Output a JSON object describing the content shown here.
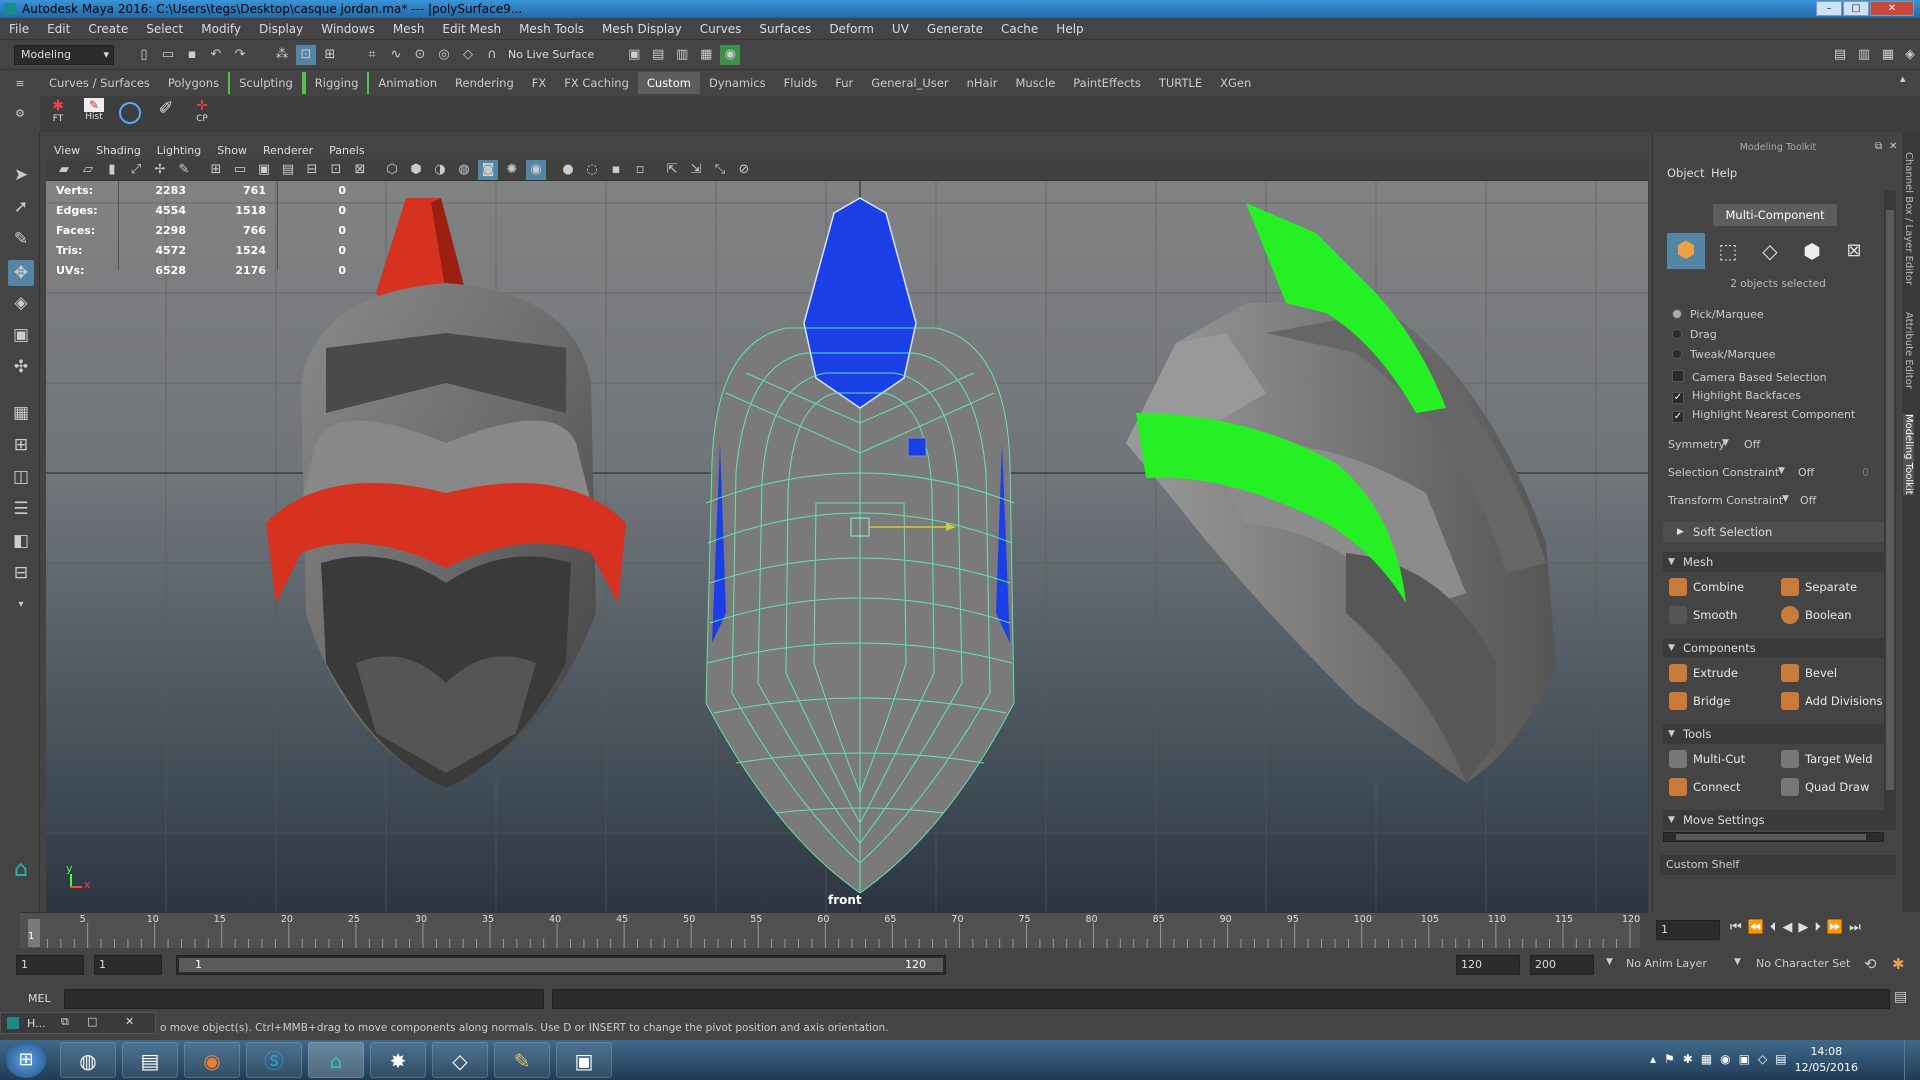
{
  "window": {
    "title": "Autodesk Maya 2016: C:\\Users\\tegs\\Desktop\\casque jordan.ma*   ---   |polySurface9..."
  },
  "menus": [
    "File",
    "Edit",
    "Create",
    "Select",
    "Modify",
    "Display",
    "Windows",
    "Mesh",
    "Edit Mesh",
    "Mesh Tools",
    "Mesh Display",
    "Curves",
    "Surfaces",
    "Deform",
    "UV",
    "Generate",
    "Cache",
    "Help"
  ],
  "status": {
    "mode": "Modeling",
    "live_surface": "No Live Surface"
  },
  "shelf_tabs": [
    "Curves / Surfaces",
    "Polygons",
    "Sculpting",
    "Rigging",
    "Animation",
    "Rendering",
    "FX",
    "FX Caching",
    "Custom",
    "Dynamics",
    "Fluids",
    "Fur",
    "General_User",
    "nHair",
    "Muscle",
    "PaintEffects",
    "TURTLE",
    "XGen"
  ],
  "shelf_active": "Custom",
  "shelf_icons": [
    {
      "label": "FT"
    },
    {
      "label": "Hist"
    },
    {
      "label": ""
    },
    {
      "label": ""
    },
    {
      "label": "CP"
    }
  ],
  "viewport_menu": [
    "View",
    "Shading",
    "Lighting",
    "Show",
    "Renderer",
    "Panels"
  ],
  "hud": [
    {
      "label": "Verts:",
      "a": "2283",
      "b": "761",
      "c": "0"
    },
    {
      "label": "Edges:",
      "a": "4554",
      "b": "1518",
      "c": "0"
    },
    {
      "label": "Faces:",
      "a": "2298",
      "b": "766",
      "c": "0"
    },
    {
      "label": "Tris:",
      "a": "4572",
      "b": "1524",
      "c": "0"
    },
    {
      "label": "UVs:",
      "a": "6528",
      "b": "2176",
      "c": "0"
    }
  ],
  "camera_label": "front",
  "axis_y": "y",
  "axis_x": "x",
  "toolkit": {
    "header": "Modeling Toolkit",
    "menu": [
      "Object",
      "Help"
    ],
    "mode": "Multi-Component",
    "selected": "2 objects selected",
    "radios": [
      {
        "label": "Pick/Marquee",
        "on": true
      },
      {
        "label": "Drag",
        "on": false
      },
      {
        "label": "Tweak/Marquee",
        "on": false
      }
    ],
    "checks": [
      {
        "label": "Camera Based Selection",
        "on": false
      },
      {
        "label": "Highlight Backfaces",
        "on": true
      },
      {
        "label": "Highlight Nearest Component",
        "on": true
      }
    ],
    "symmetry_label": "Symmetry",
    "symmetry_value": "Off",
    "sel_constraint_label": "Selection Constraint",
    "sel_constraint_value": "Off",
    "sel_constraint_num": "0",
    "xform_constraint_label": "Transform Constraint",
    "xform_constraint_value": "Off",
    "soft_selection": "Soft Selection",
    "sections": {
      "mesh": {
        "title": "Mesh",
        "buttons": [
          "Combine",
          "Separate",
          "Smooth",
          "Boolean"
        ]
      },
      "components": {
        "title": "Components",
        "buttons": [
          "Extrude",
          "Bevel",
          "Bridge",
          "Add Divisions"
        ]
      },
      "tools": {
        "title": "Tools",
        "buttons": [
          "Multi-Cut",
          "Target Weld",
          "Connect",
          "Quad Draw"
        ]
      },
      "move": {
        "title": "Move Settings"
      }
    },
    "custom_shelf": "Custom Shelf"
  },
  "side_tabs": [
    "Channel Box / Layer Editor",
    "Attribute Editor",
    "Modeling Toolkit"
  ],
  "timeline": {
    "ticks": [
      "5",
      "10",
      "15",
      "20",
      "25",
      "30",
      "35",
      "40",
      "45",
      "50",
      "55",
      "60",
      "65",
      "70",
      "75",
      "80",
      "85",
      "90",
      "95",
      "100",
      "105",
      "110",
      "115",
      "120"
    ],
    "current": "1",
    "frame_field": "1"
  },
  "range": {
    "start": "1",
    "start2": "1",
    "slider_start": "1",
    "slider_end": "120",
    "end": "120",
    "end2": "200",
    "anim_layer": "No Anim Layer",
    "char_set": "No Character Set"
  },
  "cmd": {
    "label": "MEL"
  },
  "help_text": "o move object(s). Ctrl+MMB+drag to move components along normals. Use D or INSERT to change the pivot position and axis orientation.",
  "minipanel": {
    "label": "H..."
  },
  "clock": {
    "time": "14:08",
    "date": "12/05/2016"
  }
}
